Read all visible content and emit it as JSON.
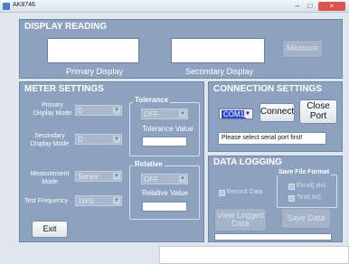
{
  "window": {
    "title": "AK8746",
    "close_glyph": "×",
    "min_glyph": "–",
    "max_glyph": "□"
  },
  "display_reading": {
    "header": "DISPLAY READING",
    "primary_label": "Primary Display",
    "secondary_label": "Secondary Display",
    "measure_label": "Measure"
  },
  "meter_settings": {
    "header": "METER SETTINGS",
    "primary_mode_label": "Primary\nDisplay Mode",
    "primary_mode_value": "D",
    "secondary_mode_label": "Secondary\nDisplay Mode",
    "secondary_mode_value": "D",
    "measurement_mode_label": "Measurement\nMode",
    "measurement_mode_value": "Series",
    "test_frequency_label": "Test Frequency",
    "test_frequency_value": "1kHz",
    "tolerance_header": "Tolerance",
    "tolerance_value": "OFF",
    "tolerance_value_label": "Tolerance Value",
    "relative_header": "Relative",
    "relative_value": "OFF",
    "relative_value_label": "Relative Value",
    "exit_label": "Exit"
  },
  "connection_settings": {
    "header": "CONNECTION SETTINGS",
    "port_value": "COM1",
    "connect_label": "Connect",
    "close_port_label": "Close\nPort",
    "status_message": "Please select serial port first!"
  },
  "data_logging": {
    "header": "DATA LOGGING",
    "save_format_header": "Save File Format",
    "record_data_label": "Record Data",
    "excel_label": "Excel(.xls)",
    "text_label": "Text(.txt)",
    "view_logged_label": "View Logged\nData",
    "save_data_label": "Save Data"
  },
  "icons": {
    "dropdown": "chevron-down-icon",
    "app": "app-icon"
  },
  "colors": {
    "panel": "#8da2bf",
    "accent": "#2a4bd0",
    "close": "#d9534f"
  }
}
